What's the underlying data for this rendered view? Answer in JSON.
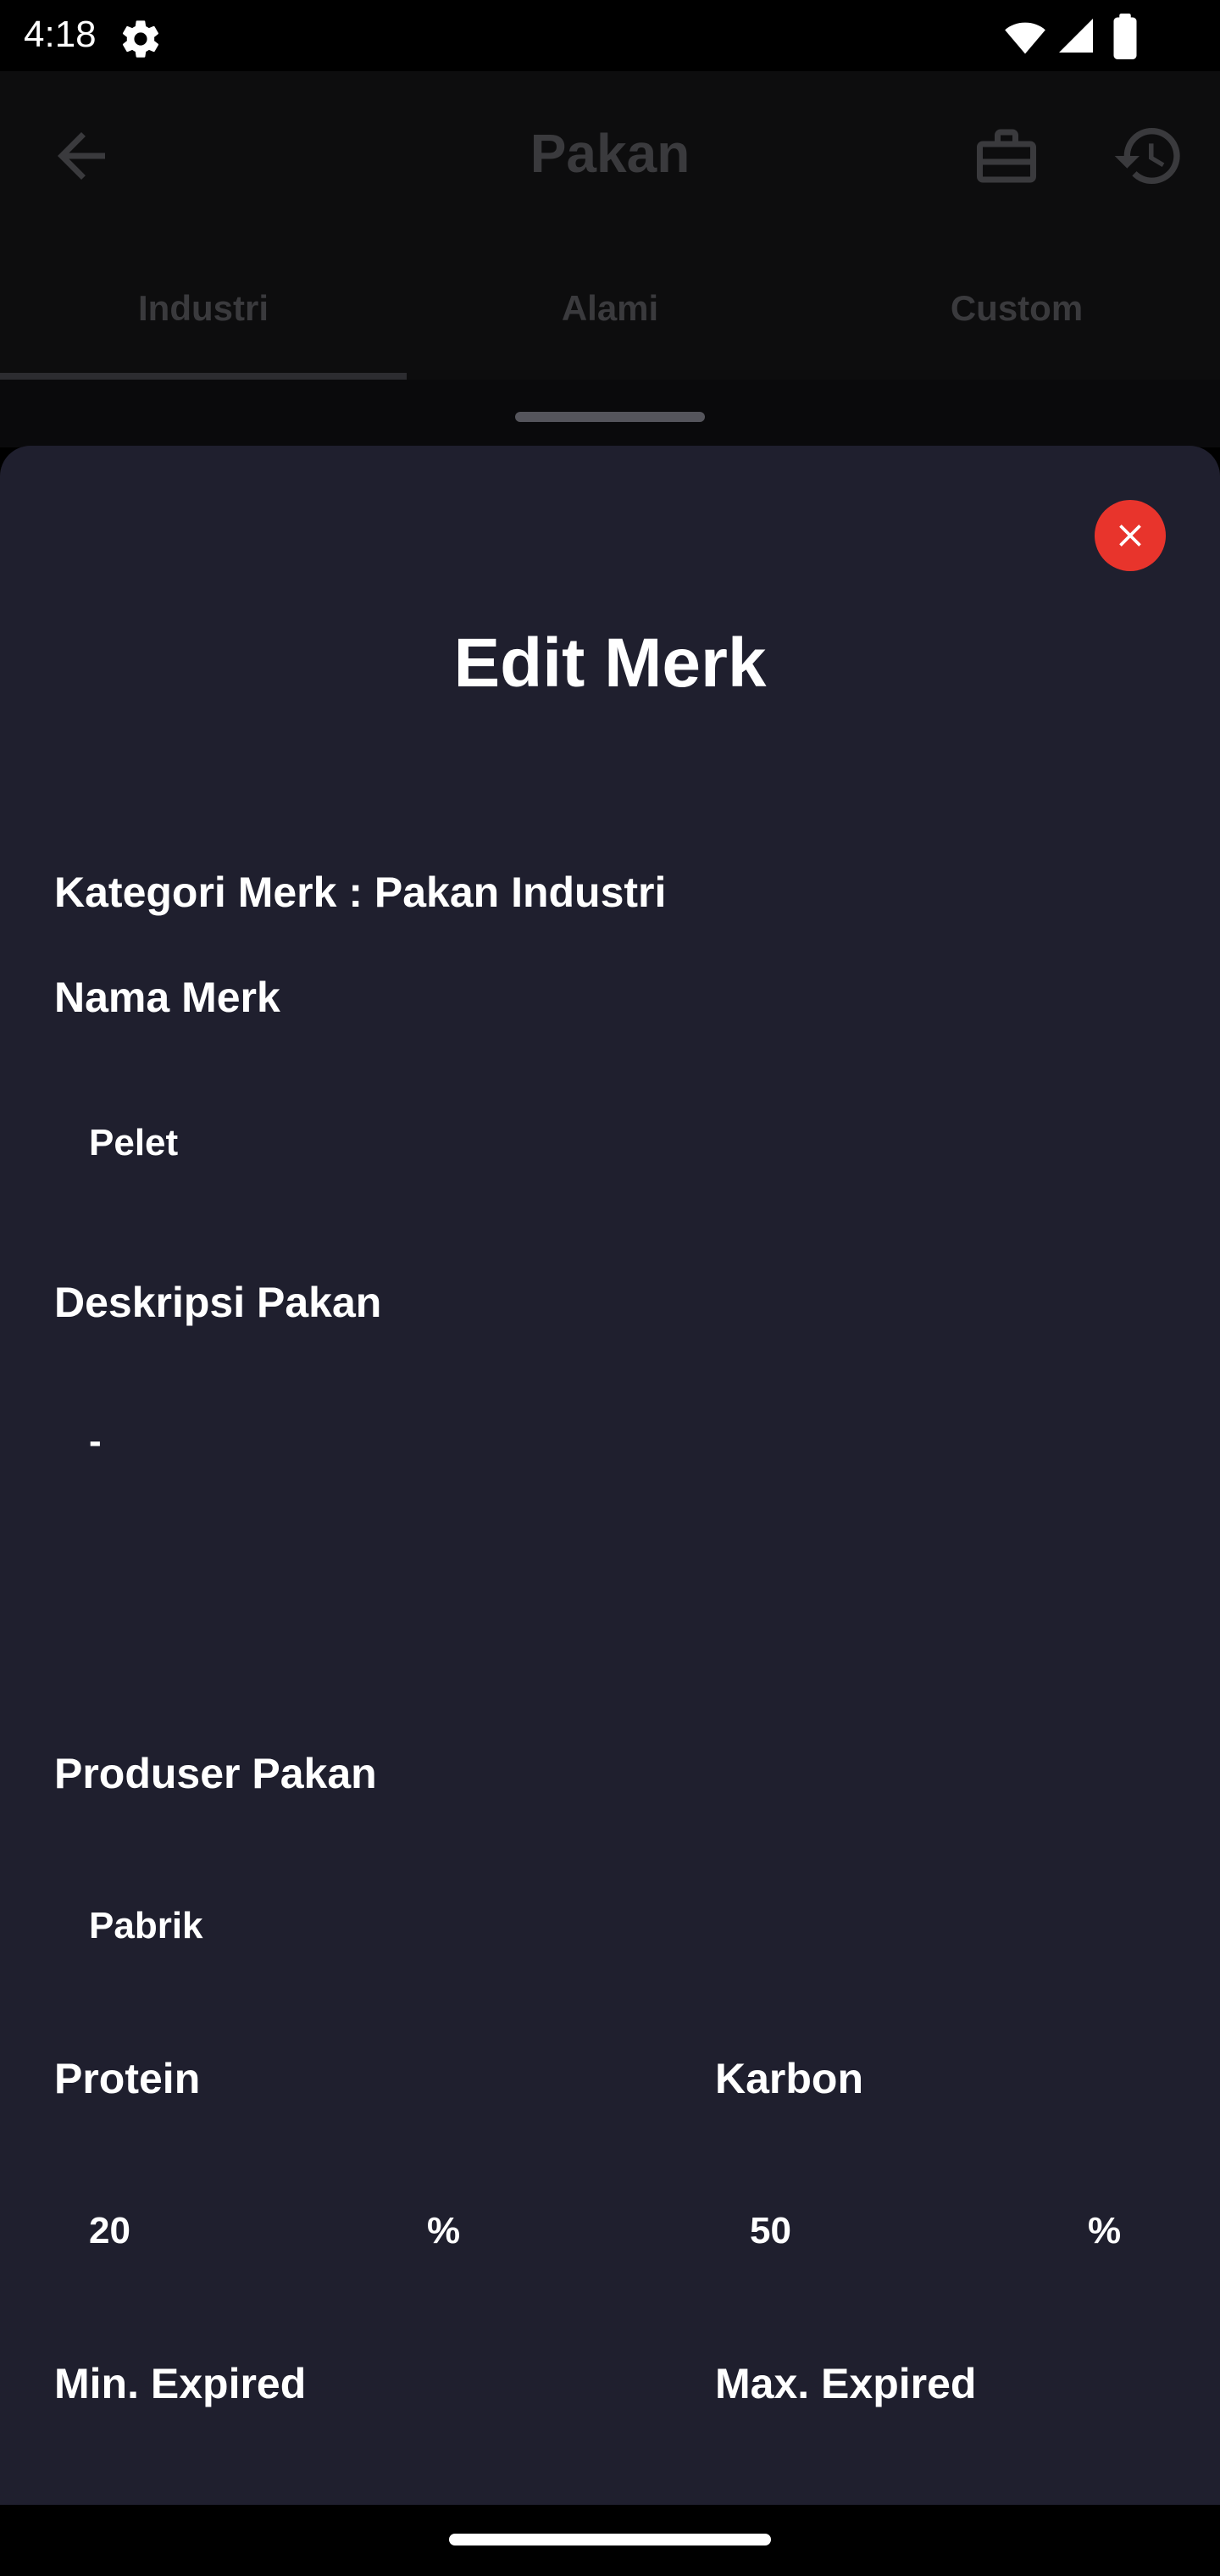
{
  "status_bar": {
    "time": "4:18"
  },
  "app_bar": {
    "title": "Pakan"
  },
  "tabs": [
    {
      "label": "Industri",
      "selected": true
    },
    {
      "label": "Alami",
      "selected": false
    },
    {
      "label": "Custom",
      "selected": false
    }
  ],
  "sheet": {
    "title": "Edit Merk",
    "kategori_label": "Kategori Merk : Pakan Industri",
    "nama_merk": {
      "label": "Nama Merk",
      "value": "Pelet"
    },
    "deskripsi": {
      "label": "Deskripsi Pakan",
      "value": "-"
    },
    "produser": {
      "label": "Produser Pakan",
      "value": "Pabrik"
    },
    "protein": {
      "label": "Protein",
      "value": "20",
      "unit": "%"
    },
    "karbon": {
      "label": "Karbon",
      "value": "50",
      "unit": "%"
    },
    "min_expired": {
      "label": "Min. Expired"
    },
    "max_expired": {
      "label": "Max. Expired"
    }
  },
  "colors": {
    "close_button": "#e8342c",
    "sheet_background": "#1f1f2e"
  }
}
